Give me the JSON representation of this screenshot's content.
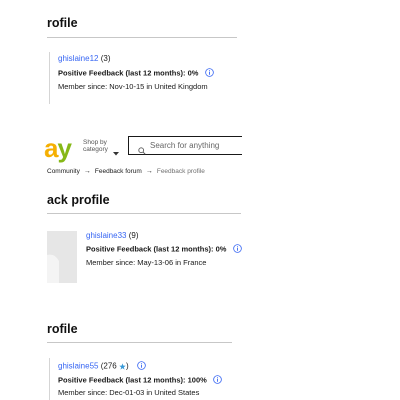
{
  "sections": {
    "top": {
      "heading": "rofile",
      "username": "ghislaine12",
      "count": "(3)",
      "feedback_label": "Positive Feedback (last 12 months): 0%",
      "member_since": "Member since: Nov-10-15 in United Kingdom"
    },
    "middle": {
      "heading": "ack profile",
      "username": "ghislaine33",
      "count": "(9)",
      "feedback_label": "Positive Feedback (last 12 months): 0%",
      "member_since": "Member since: May-13-06 in France"
    },
    "bottom": {
      "heading": "rofile",
      "username": "ghislaine55",
      "count": "(276",
      "count_close": ")",
      "feedback_label": "Positive Feedback (last 12 months): 100%",
      "member_since": "Member since: Dec-01-03 in United States"
    }
  },
  "header": {
    "logo_a": "a",
    "logo_y": "y",
    "shop_line1": "Shop by",
    "shop_line2": "category",
    "search_placeholder": "Search for anything"
  },
  "breadcrumb": {
    "item1": "Community",
    "item2": "Feedback forum",
    "item3": "Feedback profile"
  },
  "colors": {
    "link": "#3665f3",
    "ebay_a": "#f5af02",
    "ebay_y": "#86b817"
  }
}
